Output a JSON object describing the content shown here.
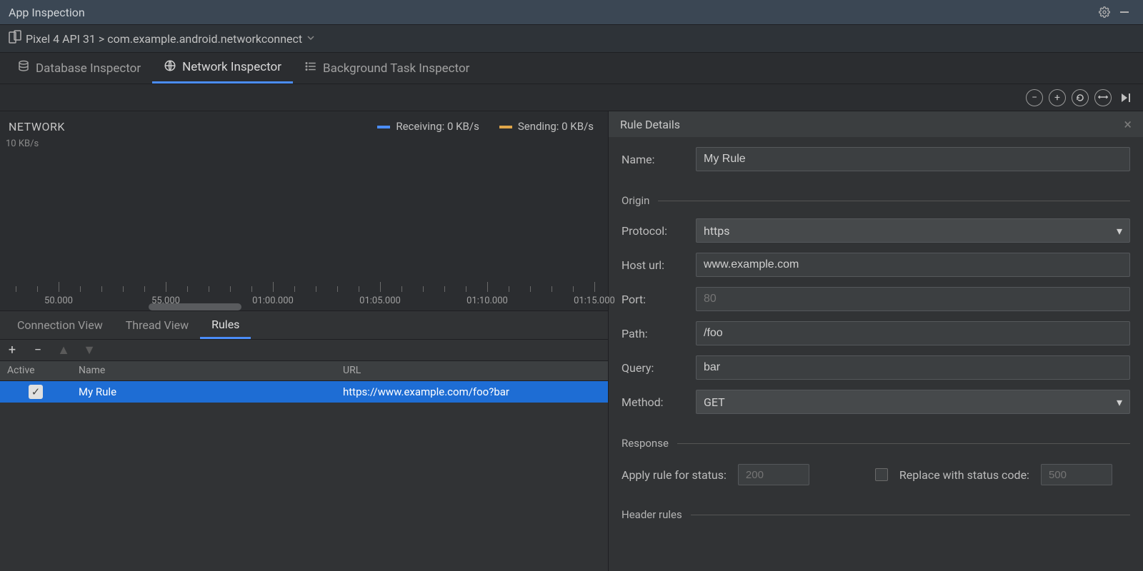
{
  "titlebar": {
    "title": "App Inspection"
  },
  "breadcrumb": {
    "text": "Pixel 4 API 31 > com.example.android.networkconnect"
  },
  "inspector_tabs": {
    "database": "Database Inspector",
    "network": "Network Inspector",
    "background": "Background Task Inspector"
  },
  "network_chart": {
    "title": "NETWORK",
    "yaxis_label": "10 KB/s",
    "receiving_label": "Receiving:",
    "receiving_value": "0 KB/s",
    "receiving_color": "#4b8df8",
    "sending_label": "Sending:",
    "sending_value": "0 KB/s",
    "sending_color": "#e0a64a",
    "timeline_ticks": [
      "50.000",
      "55.000",
      "01:00.000",
      "01:05.000",
      "01:10.000",
      "01:15.000"
    ]
  },
  "lower_tabs": {
    "connection": "Connection View",
    "thread": "Thread View",
    "rules": "Rules"
  },
  "rules_table": {
    "headers": {
      "active": "Active",
      "name": "Name",
      "url": "URL"
    },
    "rows": [
      {
        "active": true,
        "name": "My Rule",
        "url": "https://www.example.com/foo?bar"
      }
    ]
  },
  "details": {
    "title": "Rule Details",
    "name_label": "Name:",
    "name_value": "My Rule",
    "origin_label": "Origin",
    "protocol_label": "Protocol:",
    "protocol_value": "https",
    "host_label": "Host url:",
    "host_value": "www.example.com",
    "port_label": "Port:",
    "port_placeholder": "80",
    "path_label": "Path:",
    "path_value": "/foo",
    "query_label": "Query:",
    "query_value": "bar",
    "method_label": "Method:",
    "method_value": "GET",
    "response_label": "Response",
    "apply_rule_label": "Apply rule for status:",
    "apply_rule_placeholder": "200",
    "replace_label": "Replace with status code:",
    "replace_placeholder": "500",
    "header_rules_label": "Header rules"
  }
}
